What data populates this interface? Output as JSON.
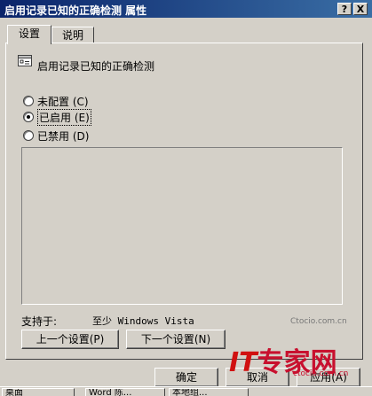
{
  "window": {
    "title": "启用记录已知的正确检测 属性",
    "help_button": "?",
    "close_button": "X"
  },
  "tabs": [
    {
      "label": "设置",
      "active": true
    },
    {
      "label": "说明",
      "active": false
    }
  ],
  "policy": {
    "name": "启用记录已知的正确检测",
    "icon": "policy-setting-icon"
  },
  "options": [
    {
      "label": "未配置",
      "accel": "(C)",
      "checked": false
    },
    {
      "label": "已启用",
      "accel": "(E)",
      "checked": true
    },
    {
      "label": "已禁用",
      "accel": "(D)",
      "checked": false
    }
  ],
  "supported": {
    "label": "支持于:",
    "value": "至少 Windows Vista"
  },
  "nav": {
    "prev": "上一个设置(P)",
    "next": "下一个设置(N)"
  },
  "actions": {
    "ok": "确定",
    "cancel": "取消",
    "apply": "应用(A)"
  },
  "watermark": {
    "brand": "IT专家网",
    "brand_it": "IT",
    "brand_cn": "专家网",
    "url": "ctocio.com.cn",
    "url_top": "Ctocio.com.cn"
  },
  "taskbar": {
    "items": [
      "桌面",
      "Word 陈...",
      "本地组..."
    ]
  }
}
